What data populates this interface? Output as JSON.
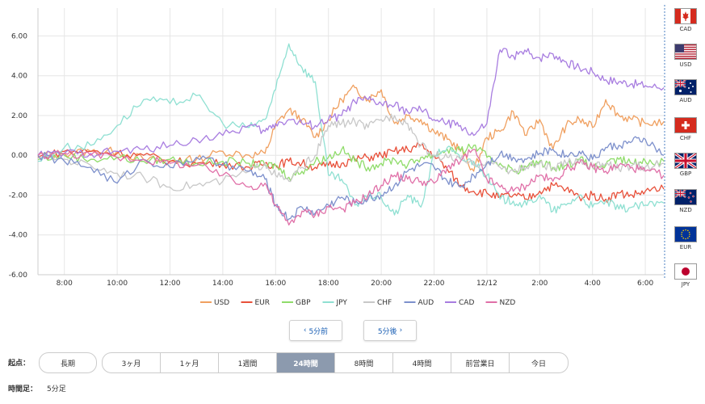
{
  "chart_data": {
    "type": "line",
    "ylim": [
      -6,
      7.4
    ],
    "yticks": [
      "6.00",
      "4.00",
      "2.00",
      "0.00",
      "-2.00",
      "-4.00",
      "-6.00"
    ],
    "ytick_values": [
      6,
      4,
      2,
      0,
      -2,
      -4,
      -6
    ],
    "xlim": [
      0,
      34
    ],
    "xticks": [
      "8:00",
      "10:00",
      "12:00",
      "14:00",
      "16:00",
      "18:00",
      "20:00",
      "22:00",
      "12/12",
      "2:00",
      "4:00",
      "6:00"
    ],
    "xtick_values": [
      1,
      3,
      5,
      7,
      9,
      11,
      13,
      15,
      17,
      19,
      21,
      23
    ],
    "grid": true,
    "legend_position": "bottom",
    "series": [
      {
        "name": "USD",
        "color": "#f0a060",
        "x": [
          0,
          1,
          2,
          3,
          4,
          5,
          6,
          7,
          8,
          8.6,
          9,
          9.5,
          10,
          10.5,
          11,
          11.5,
          12,
          12.5,
          13,
          13.5,
          14,
          14.5,
          15,
          15.5,
          16,
          16.5,
          17,
          17.5,
          18,
          18.5,
          19,
          19.5,
          20,
          20.5,
          21,
          21.5,
          22,
          22.5,
          23,
          23.7
        ],
        "values": [
          0,
          0.1,
          0.2,
          0.2,
          -0.2,
          -0.3,
          -0.2,
          0.2,
          0.0,
          0.1,
          1.5,
          2.3,
          1.8,
          0.9,
          1.8,
          2.8,
          3.4,
          2.8,
          3.3,
          1.6,
          2.0,
          1.8,
          1.2,
          0.8,
          0.3,
          -0.8,
          0.9,
          1.2,
          2.2,
          1.0,
          1.8,
          0.3,
          1.5,
          1.8,
          1.4,
          2.8,
          2.0,
          1.8,
          1.6,
          1.7
        ]
      },
      {
        "name": "EUR",
        "color": "#e8503a",
        "x": [
          0,
          1,
          2,
          3,
          4,
          5,
          6,
          7,
          8,
          8.6,
          9,
          9.5,
          10,
          10.5,
          11,
          11.5,
          12,
          12.5,
          13,
          13.5,
          14,
          14.5,
          15,
          15.5,
          16,
          16.5,
          17,
          17.5,
          18,
          18.5,
          19,
          19.5,
          20,
          20.5,
          21,
          21.5,
          22,
          22.5,
          23,
          23.7
        ],
        "values": [
          -0.1,
          0.2,
          0.2,
          0.1,
          0.0,
          -0.3,
          -0.4,
          -0.4,
          -0.6,
          -0.4,
          -0.5,
          -0.3,
          -0.4,
          -0.6,
          -0.5,
          -0.4,
          -0.2,
          -0.1,
          0.0,
          0.2,
          0.3,
          0.5,
          0.0,
          -0.7,
          -1.5,
          -1.8,
          -1.9,
          -2.1,
          -2.0,
          -2.2,
          -1.8,
          -1.5,
          -1.7,
          -2.1,
          -2.0,
          -2.2,
          -1.9,
          -2.0,
          -1.8,
          -1.7
        ]
      },
      {
        "name": "GBP",
        "color": "#8fdc6a",
        "x": [
          0,
          1,
          2,
          3,
          4,
          5,
          6,
          7,
          8,
          8.6,
          9,
          9.5,
          10,
          10.5,
          11,
          11.5,
          12,
          12.5,
          13,
          13.5,
          14,
          14.5,
          15,
          15.5,
          16,
          16.5,
          17,
          17.5,
          18,
          18.5,
          19,
          19.5,
          20,
          20.5,
          21,
          21.5,
          22,
          22.5,
          23,
          23.7
        ],
        "values": [
          -0.2,
          0.0,
          -0.2,
          -0.1,
          -0.3,
          -0.2,
          -0.4,
          -0.3,
          -0.4,
          -0.5,
          -0.5,
          -1.1,
          -0.8,
          -0.3,
          -0.1,
          0.3,
          -0.3,
          -0.6,
          -0.4,
          -0.2,
          -0.5,
          -0.1,
          0.0,
          0.3,
          0.2,
          0.5,
          -0.1,
          -0.4,
          -0.8,
          -0.6,
          -0.3,
          -0.6,
          -0.5,
          -0.2,
          -0.6,
          -0.5,
          -0.2,
          -0.4,
          -0.3,
          -0.3
        ]
      },
      {
        "name": "JPY",
        "color": "#8fe0d2",
        "x": [
          0,
          1,
          2,
          3,
          4,
          5,
          6,
          7,
          8,
          8.6,
          9,
          9.5,
          10,
          10.5,
          11,
          11.5,
          12,
          12.5,
          13,
          13.5,
          14,
          14.5,
          15,
          15.5,
          16,
          16.5,
          17,
          17.5,
          18,
          18.5,
          19,
          19.5,
          20,
          20.5,
          21,
          21.5,
          22,
          22.5,
          23,
          23.7
        ],
        "values": [
          -0.3,
          0.4,
          0.5,
          1.5,
          2.8,
          2.6,
          3.0,
          1.6,
          1.4,
          1.8,
          3.3,
          5.6,
          4.4,
          3.7,
          -1.0,
          -1.2,
          -2.5,
          -2.0,
          -2.1,
          -3.0,
          -2.0,
          -2.6,
          0.0,
          0.4,
          -0.2,
          -0.3,
          -1.0,
          -2.2,
          -2.3,
          -2.5,
          -2.0,
          -2.8,
          -2.5,
          -2.0,
          -2.6,
          -2.3,
          -2.7,
          -2.6,
          -2.5,
          -2.4
        ]
      },
      {
        "name": "CHF",
        "color": "#c8c8c8",
        "x": [
          0,
          1,
          2,
          3,
          4,
          5,
          6,
          7,
          8,
          8.6,
          9,
          9.5,
          10,
          10.5,
          11,
          11.5,
          12,
          12.5,
          13,
          13.5,
          14,
          14.5,
          15,
          15.5,
          16,
          16.5,
          17,
          17.5,
          18,
          18.5,
          19,
          19.5,
          20,
          20.5,
          21,
          21.5,
          22,
          22.5,
          23,
          23.7
        ],
        "values": [
          0,
          -0.2,
          -0.5,
          -0.9,
          -1.1,
          -1.6,
          -1.5,
          -1.3,
          -0.8,
          -0.4,
          -1.0,
          -1.3,
          -0.6,
          0.0,
          1.5,
          1.6,
          1.7,
          1.4,
          1.8,
          2.0,
          1.6,
          0.5,
          0.0,
          -0.1,
          -0.2,
          -0.5,
          -0.3,
          -0.6,
          -0.8,
          -0.6,
          -0.4,
          -0.7,
          -0.4,
          -0.2,
          -0.6,
          -0.4,
          -0.7,
          -0.5,
          -0.6,
          -0.4
        ]
      },
      {
        "name": "AUD",
        "color": "#7d90cc",
        "x": [
          0,
          1,
          2,
          3,
          4,
          5,
          6,
          7,
          8,
          8.6,
          9,
          9.5,
          10,
          10.5,
          11,
          11.5,
          12,
          12.5,
          13,
          13.5,
          14,
          14.5,
          15,
          15.5,
          16,
          16.5,
          17,
          17.5,
          18,
          18.5,
          19,
          19.5,
          20,
          20.5,
          21,
          21.5,
          22,
          22.5,
          23,
          23.7
        ],
        "values": [
          0,
          -0.3,
          -0.6,
          -1.4,
          -0.2,
          -0.6,
          -0.1,
          -0.5,
          -0.8,
          -1.2,
          -2.5,
          -3.2,
          -2.6,
          -2.9,
          -2.5,
          -2.1,
          -2.4,
          -2.2,
          -2.0,
          -1.5,
          -0.8,
          -0.5,
          -0.6,
          -1.3,
          -1.6,
          -1.0,
          -0.4,
          0.1,
          -0.1,
          -0.2,
          0.1,
          0.3,
          0.0,
          0.2,
          -0.2,
          0.4,
          0.5,
          0.7,
          0.8,
          0.0
        ]
      },
      {
        "name": "CAD",
        "color": "#a87de0",
        "x": [
          0,
          1,
          2,
          3,
          4,
          5,
          6,
          7,
          8,
          8.6,
          9,
          9.5,
          10,
          10.5,
          11,
          11.5,
          12,
          12.5,
          13,
          13.5,
          14,
          14.5,
          15,
          15.5,
          16,
          16.5,
          17,
          17.5,
          18,
          18.5,
          19,
          19.5,
          20,
          20.5,
          21,
          21.5,
          22,
          22.5,
          23,
          23.7
        ],
        "values": [
          0,
          0.1,
          0.1,
          0.2,
          0.3,
          0.5,
          0.8,
          1.0,
          1.5,
          1.2,
          1.6,
          1.8,
          1.6,
          1.5,
          1.8,
          2.0,
          2.7,
          2.8,
          2.6,
          2.5,
          2.2,
          2.3,
          1.8,
          1.6,
          1.5,
          1.0,
          1.6,
          5.3,
          5.0,
          5.2,
          4.9,
          5.1,
          4.7,
          4.4,
          4.2,
          3.8,
          3.7,
          3.6,
          3.5,
          3.4
        ]
      },
      {
        "name": "NZD",
        "color": "#e070a8",
        "x": [
          0,
          1,
          2,
          3,
          4,
          5,
          6,
          7,
          8,
          8.6,
          9,
          9.5,
          10,
          10.5,
          11,
          11.5,
          12,
          12.5,
          13,
          13.5,
          14,
          14.5,
          15,
          15.5,
          16,
          16.5,
          17,
          17.5,
          18,
          18.5,
          19,
          19.5,
          20,
          20.5,
          21,
          21.5,
          22,
          22.5,
          23,
          23.7
        ],
        "values": [
          0,
          0.1,
          0.0,
          -0.1,
          -0.2,
          -0.4,
          -0.5,
          -1.0,
          -1.6,
          -1.4,
          -2.5,
          -3.5,
          -2.8,
          -3.0,
          -2.6,
          -2.7,
          -2.4,
          -2.0,
          -1.5,
          -1.0,
          -1.2,
          -1.3,
          -1.4,
          -0.6,
          -0.3,
          0.3,
          -1.2,
          -1.6,
          -1.8,
          -1.5,
          -1.0,
          -1.3,
          -0.7,
          -0.4,
          -0.6,
          -0.8,
          -0.5,
          -0.6,
          -0.8,
          -1.0
        ]
      }
    ]
  },
  "flags": [
    {
      "code": "CAD",
      "flag_icon": "canada-flag-icon"
    },
    {
      "code": "USD",
      "flag_icon": "usa-flag-icon"
    },
    {
      "code": "AUD",
      "flag_icon": "australia-flag-icon"
    },
    {
      "code": "CHF",
      "flag_icon": "switzerland-flag-icon"
    },
    {
      "code": "GBP",
      "flag_icon": "uk-flag-icon"
    },
    {
      "code": "NZD",
      "flag_icon": "new-zealand-flag-icon"
    },
    {
      "code": "EUR",
      "flag_icon": "eu-flag-icon"
    },
    {
      "code": "JPY",
      "flag_icon": "japan-flag-icon"
    }
  ],
  "nav": {
    "prev_label": "5分前",
    "next_label": "5分後",
    "prev_icon": "chevron-left-icon",
    "next_icon": "chevron-right-icon"
  },
  "controls": {
    "start_label": "起点：",
    "long_term_label": "長期",
    "periods": [
      "3ヶ月",
      "1ヶ月",
      "1週間",
      "24時間",
      "8時間",
      "4時間",
      "前営業日",
      "今日"
    ],
    "active_period": "24時間",
    "footer_label": "時間足：",
    "footer_value": "5分足"
  },
  "colors": {
    "active_segment": "#8c9aae",
    "nav_text": "#1a5fb4"
  }
}
